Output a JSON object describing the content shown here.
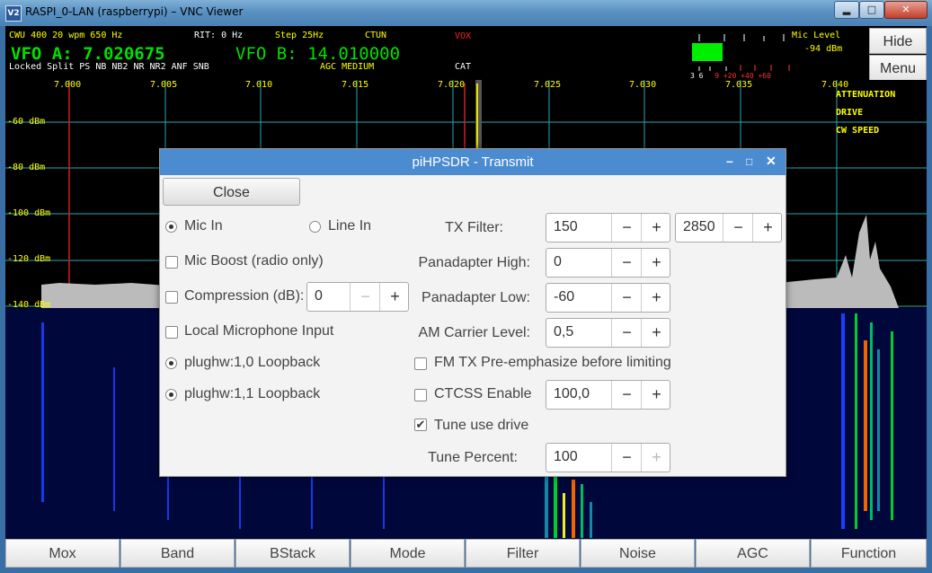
{
  "window": {
    "title": "RASPI_0-LAN (raspberrypi) – VNC Viewer",
    "icon": "vnc-logo-icon",
    "app_icon_text": "V2",
    "min_label": "▂",
    "max_label": "□",
    "close_label": "✕"
  },
  "status": {
    "line1": "CWU 400 20 wpm 650 Hz",
    "rit": "RIT: 0 Hz",
    "step": "Step 25Hz",
    "ctun": "CTUN",
    "vox": "VOX",
    "vfo_a": "VFO A: 7.020675",
    "vfo_b": "VFO B: 14.010000",
    "line3": "Locked Split  PS    NB  NB2 NR  NR2 ANF SNB",
    "agc": "AGC MEDIUM",
    "cat": "CAT"
  },
  "meter": {
    "title": "Mic Level",
    "value": "-94 dBm",
    "scale_white": "3  6",
    "scale_red": "9 +20 +40 +60"
  },
  "side_buttons": {
    "hide": "Hide",
    "menu": "Menu"
  },
  "panadapter": {
    "freqs": [
      "7.000",
      "7.005",
      "7.010",
      "7.015",
      "7.020",
      "7.025",
      "7.030",
      "7.035",
      "7.040"
    ],
    "dbm": [
      "-60 dBm",
      "-80 dBm",
      "-100 dBm",
      "-120 dBm",
      "-140 dBm"
    ],
    "right_labels": [
      "ATTENUATION",
      "DRIVE",
      "CW SPEED"
    ]
  },
  "dialog": {
    "title": "piHPSDR - Transmit",
    "close": "Close",
    "mic_in": "Mic In",
    "line_in": "Line In",
    "mic_boost": "Mic Boost (radio only)",
    "compression": "Compression (dB):",
    "compression_value": "0",
    "local_mic": "Local Microphone Input",
    "plughw10": "plughw:1,0 Loopback",
    "plughw11": "plughw:1,1 Loopback",
    "tx_filter": "TX Filter:",
    "tx_low": "150",
    "tx_high": "2850",
    "pan_high": "Panadapter High:",
    "pan_high_value": "0",
    "pan_low": "Panadapter Low:",
    "pan_low_value": "-60",
    "am_carrier": "AM Carrier Level:",
    "am_carrier_value": "0,5",
    "fm_pre": "FM TX Pre-emphasize before limiting",
    "ctcss": "CTCSS Enable",
    "ctcss_value": "100,0",
    "tune_drive": "Tune use drive",
    "tune_percent": "Tune Percent:",
    "tune_percent_value": "100",
    "minus": "−",
    "plus": "+",
    "minimize": "–",
    "maximize": "□",
    "close_x": "✕"
  },
  "bottom_buttons": [
    "Mox",
    "Band",
    "BStack",
    "Mode",
    "Filter",
    "Noise",
    "AGC",
    "Function"
  ]
}
